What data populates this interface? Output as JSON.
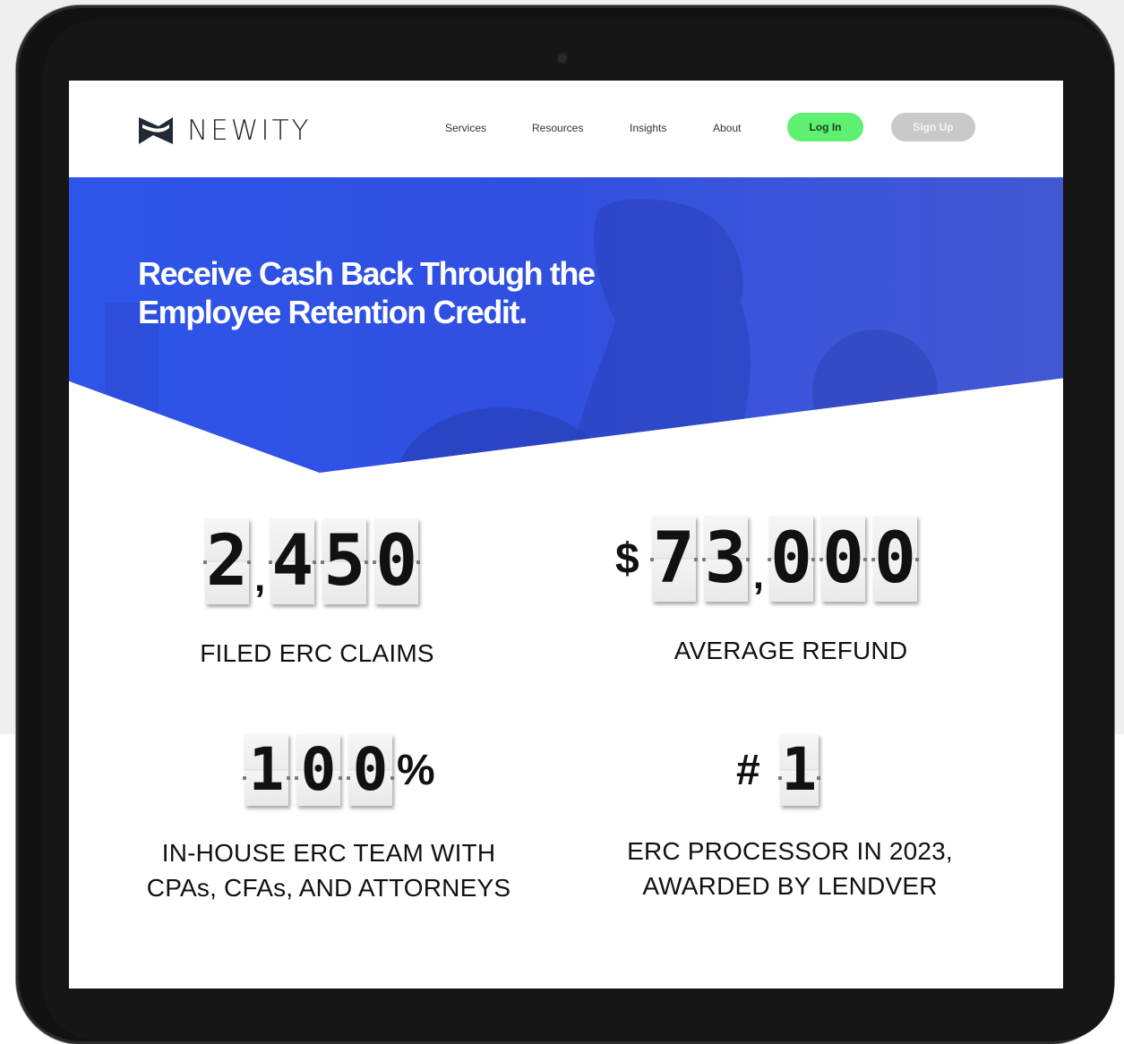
{
  "nav": {
    "brand": "NEWITY",
    "links": [
      "Services",
      "Resources",
      "Insights",
      "About"
    ],
    "login_label": "Log In",
    "signup_label": "Sign Up"
  },
  "hero": {
    "title": "Receive Cash Back Through the Employee Retention Credit."
  },
  "stats": [
    {
      "digits": [
        "2",
        ",",
        "4",
        "5",
        "0"
      ],
      "label": "FILED ERC CLAIMS"
    },
    {
      "prefix": "$",
      "digits": [
        "7",
        "3",
        ",",
        "0",
        "0",
        "0"
      ],
      "label": "AVERAGE REFUND"
    },
    {
      "digits": [
        "1",
        "0",
        "0"
      ],
      "suffix": "%",
      "label_line1": "IN-HOUSE ERC TEAM WITH",
      "label_line2": "CPAs, CFAs, AND ATTORNEYS"
    },
    {
      "prefix": "#",
      "digits": [
        "1"
      ],
      "label_line1": "ERC PROCESSOR IN 2023,",
      "label_line2": "AWARDED BY LENDVER"
    }
  ],
  "colors": {
    "hero_blue": "#2f52e6",
    "login_green": "#5ef171",
    "signup_grey": "#c9c9c9",
    "brand_dark": "#222a36"
  }
}
